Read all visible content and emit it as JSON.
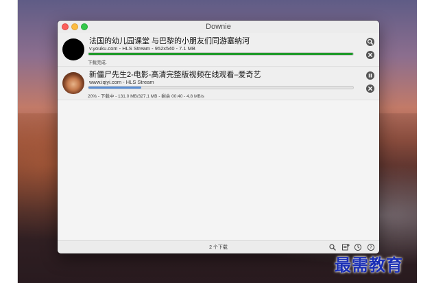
{
  "window": {
    "title": "Downie"
  },
  "downloads": [
    {
      "title": "法国的幼儿园课堂 与巴黎的小朋友们同游塞纳河",
      "source": "v.youku.com - HLS Stream - 952x540 - 7.1 MB",
      "status": "下载完成.",
      "progress": 1.0,
      "progress_color": "#1f9a2a",
      "thumbnail": "black-circle",
      "primary_action_icon": "magnifier-icon",
      "secondary_action_icon": "close-circle-icon"
    },
    {
      "title": "新僵尸先生2-电影-高清完整版视频在线观看–爱奇艺",
      "source": "www.iqiyi.com - HLS Stream",
      "status": "20% - 下载中 - 131.0 MB/327.1 MB - 剩余 00:40 - 4.8 MB/s",
      "progress": 0.2,
      "progress_color": "#5b8fd6",
      "thumbnail": "face-thumbnail",
      "primary_action_icon": "pause-icon",
      "secondary_action_icon": "close-circle-icon"
    }
  ],
  "footer": {
    "count_label": "2 个下载",
    "icons": [
      "search-icon",
      "add-download-icon",
      "history-icon",
      "help-icon"
    ]
  },
  "watermark": {
    "text": "最需教育"
  }
}
